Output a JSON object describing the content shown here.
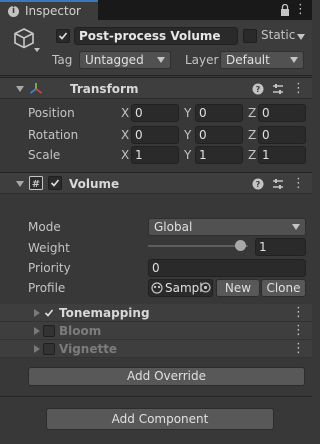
{
  "tab": {
    "title": "Inspector"
  },
  "header": {
    "object_name": "Post-process Volume",
    "static_label": "Static",
    "tag_label": "Tag",
    "tag_value": "Untagged",
    "layer_label": "Layer",
    "layer_value": "Default"
  },
  "transform": {
    "title": "Transform",
    "rows": [
      {
        "label": "Position",
        "x": "0",
        "y": "0",
        "z": "0"
      },
      {
        "label": "Rotation",
        "x": "0",
        "y": "0",
        "z": "0"
      },
      {
        "label": "Scale",
        "x": "1",
        "y": "1",
        "z": "1"
      }
    ],
    "axis": {
      "x": "X",
      "y": "Y",
      "z": "Z"
    }
  },
  "volume": {
    "title": "Volume",
    "mode_label": "Mode",
    "mode_value": "Global",
    "weight_label": "Weight",
    "weight_value": "1",
    "weight_fraction": 0.92,
    "priority_label": "Priority",
    "priority_value": "0",
    "profile_label": "Profile",
    "profile_value": "Sampl",
    "new_label": "New",
    "clone_label": "Clone"
  },
  "overrides": [
    {
      "label": "Tonemapping",
      "enabled": true
    },
    {
      "label": "Bloom",
      "enabled": false
    },
    {
      "label": "Vignette",
      "enabled": false
    }
  ],
  "buttons": {
    "add_override": "Add Override",
    "add_component": "Add Component"
  },
  "colors": {
    "accent": "#3a79bb",
    "panel": "#383838",
    "tonemap_text": "#d8d8d8",
    "disabled_text": "#7c7c7c"
  }
}
